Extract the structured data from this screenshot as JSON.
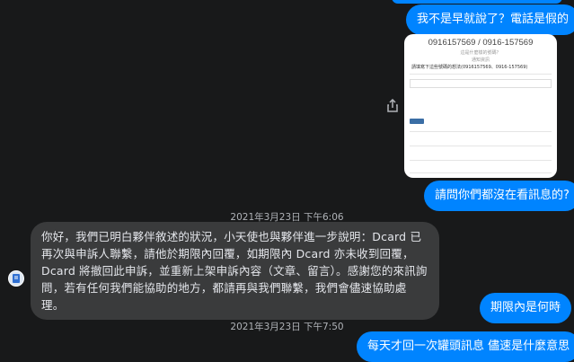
{
  "messages": {
    "out1": "我不是早就說了？電話是假的",
    "out2": "請問你們都沒在看訊息的?",
    "in1": "你好，我們已明白夥伴敘述的狀況，小天使也與夥伴進一步說明：Dcard 已再次與申訴人聯繫，請他於期限內回覆，如期限內 Dcard 亦未收到回覆， Dcard 將撤回此申訴，並重新上架申訴內容（文章、留言）。感謝您的來訊詢問，若有任何我們能協助的地方，都請再與我們聯繫，我們會儘速協助處理。",
    "out3": "期限內是何時",
    "out4": "每天才回一次罐頭訊息 儘速是什麼意思"
  },
  "timestamps": {
    "t1": "2021年3月23日 下午6:06",
    "t2": "2021年3月23日 下午7:50"
  },
  "screenshot": {
    "title": "0916157569 / 0916-157569",
    "subtitle": "這是什麼樣的號碼？",
    "small": "通知資訊",
    "line": "請填寫下這些號碼的想法(0916157569、0916-157569)"
  },
  "icons": {
    "share": "share-icon",
    "avatar": "dcard-avatar-icon"
  }
}
